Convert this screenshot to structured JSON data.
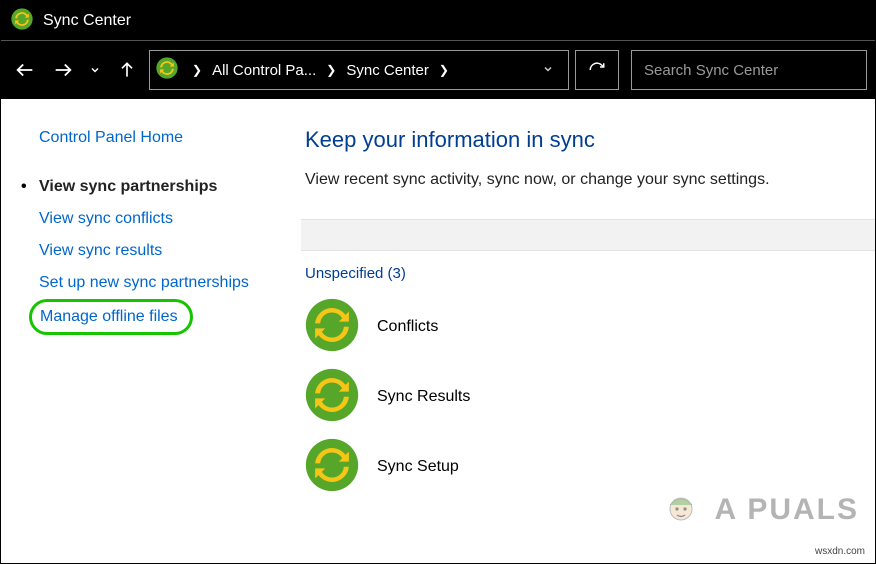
{
  "window": {
    "title": "Sync Center"
  },
  "breadcrumb": {
    "seg1": "All Control Pa...",
    "seg2": "Sync Center"
  },
  "search": {
    "placeholder": "Search Sync Center"
  },
  "sidebar": {
    "home": "Control Panel Home",
    "items": [
      {
        "label": "View sync partnerships"
      },
      {
        "label": "View sync conflicts"
      },
      {
        "label": "View sync results"
      },
      {
        "label": "Set up new sync partnerships"
      },
      {
        "label": "Manage offline files"
      }
    ]
  },
  "main": {
    "heading": "Keep your information in sync",
    "subtitle": "View recent sync activity, sync now, or change your sync settings.",
    "group_header": "Unspecified (3)",
    "items": [
      {
        "label": "Conflicts"
      },
      {
        "label": "Sync Results"
      },
      {
        "label": "Sync Setup"
      }
    ]
  },
  "watermark": {
    "text": "A PUALS"
  },
  "sourcemark": "wsxdn.com"
}
